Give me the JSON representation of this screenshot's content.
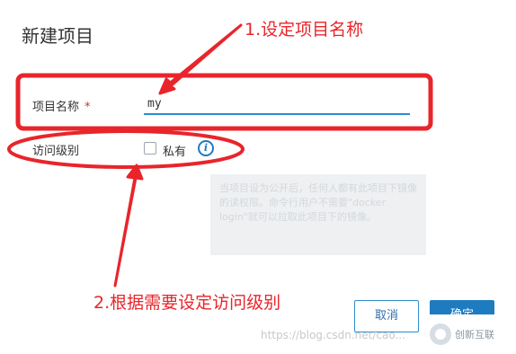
{
  "dialog": {
    "title": "新建项目",
    "name_field": {
      "label": "项目名称",
      "required_mark": "*",
      "value": "my"
    },
    "access_level": {
      "label": "访问级别",
      "checkbox_label": "私有",
      "checked": false,
      "info_icon": "info-icon"
    },
    "tooltip": "当项目设为公开后，任何人都有此项目下镜像的读权限。命令行用户不需要\"docker login\"就可以拉取此项目下的镜像。",
    "buttons": {
      "cancel_label": "取消",
      "ok_label": "确定"
    }
  },
  "annotations": {
    "step1": "1.设定项目名称",
    "step2": "2.根据需要设定访问级别",
    "color": "#e8252b"
  },
  "watermark": {
    "url": "https://blog.csdn.net/cao...",
    "brand": "创新互联"
  },
  "colors": {
    "primary": "#1f7bc0",
    "input_underline": "#2e8ccf",
    "annotation_red": "#e8252b"
  }
}
